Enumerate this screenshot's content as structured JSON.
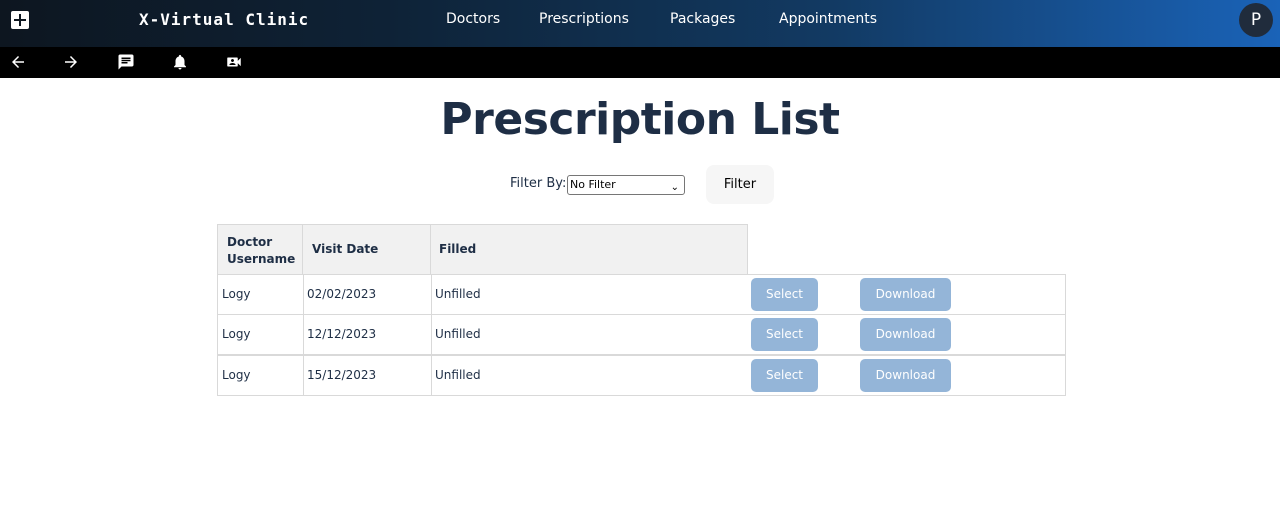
{
  "app": {
    "brand": "X-Virtual Clinic",
    "avatar_initial": "P"
  },
  "nav": {
    "items": [
      {
        "label": "Doctors"
      },
      {
        "label": "Prescriptions"
      },
      {
        "label": "Packages"
      },
      {
        "label": "Appointments"
      }
    ]
  },
  "toolbar": {
    "icons": [
      "back-arrow-icon",
      "forward-arrow-icon",
      "chat-icon",
      "bell-icon",
      "video-call-icon"
    ]
  },
  "page": {
    "title": "Prescription List"
  },
  "filter": {
    "label": "Filter By:",
    "selected": "No Filter",
    "button_label": "Filter"
  },
  "table": {
    "headers": [
      "Doctor Username",
      "Visit Date",
      "Filled"
    ],
    "rows": [
      {
        "doctor": "Logy",
        "date": "02/02/2023",
        "filled": "Unfilled",
        "select_label": "Select",
        "download_label": "Download"
      },
      {
        "doctor": "Logy",
        "date": "12/12/2023",
        "filled": "Unfilled",
        "select_label": "Select",
        "download_label": "Download"
      },
      {
        "doctor": "Logy",
        "date": "15/12/2023",
        "filled": "Unfilled",
        "select_label": "Select",
        "download_label": "Download"
      }
    ]
  },
  "colors": {
    "header_gradient_start": "#0d1620",
    "header_gradient_end": "#1a63b8",
    "title_text": "#1e2e45",
    "action_button": "#94b5d8"
  }
}
